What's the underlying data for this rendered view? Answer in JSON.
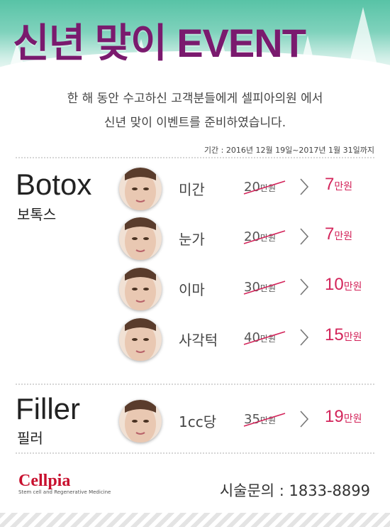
{
  "header": {
    "title": "신년 맞이 EVENT"
  },
  "intro": {
    "line1": "한 해 동안 수고하신 고객분들에게 셀피아의원 에서",
    "line2": "신년 맞이 이벤트를 준비하였습니다."
  },
  "period": "기간 : 2016년 12월 19일~2017년 1월 31일까지",
  "botox": {
    "title_en": "Botox",
    "title_ko": "보톡스",
    "items": [
      {
        "area": "미간",
        "old_value": "20",
        "old_unit": "만원",
        "new_value": "7",
        "new_unit": "만원"
      },
      {
        "area": "눈가",
        "old_value": "20",
        "old_unit": "만원",
        "new_value": "7",
        "new_unit": "만원"
      },
      {
        "area": "이마",
        "old_value": "30",
        "old_unit": "만원",
        "new_value": "10",
        "new_unit": "만원"
      },
      {
        "area": "사각턱",
        "old_value": "40",
        "old_unit": "만원",
        "new_value": "15",
        "new_unit": "만원"
      }
    ]
  },
  "filler": {
    "title_en": "Filler",
    "title_ko": "필러",
    "items": [
      {
        "area": "1cc당",
        "old_value": "35",
        "old_unit": "만원",
        "new_value": "19",
        "new_unit": "만원"
      }
    ]
  },
  "footer": {
    "logo_text": "Cellpia",
    "logo_sub": "Stem cell and Regenerative Medicine",
    "contact": "시술문의 : 1833-8899"
  },
  "colors": {
    "accent": "#d3245a",
    "title": "#7a1a6e",
    "header_bg": "#58c3a6"
  }
}
